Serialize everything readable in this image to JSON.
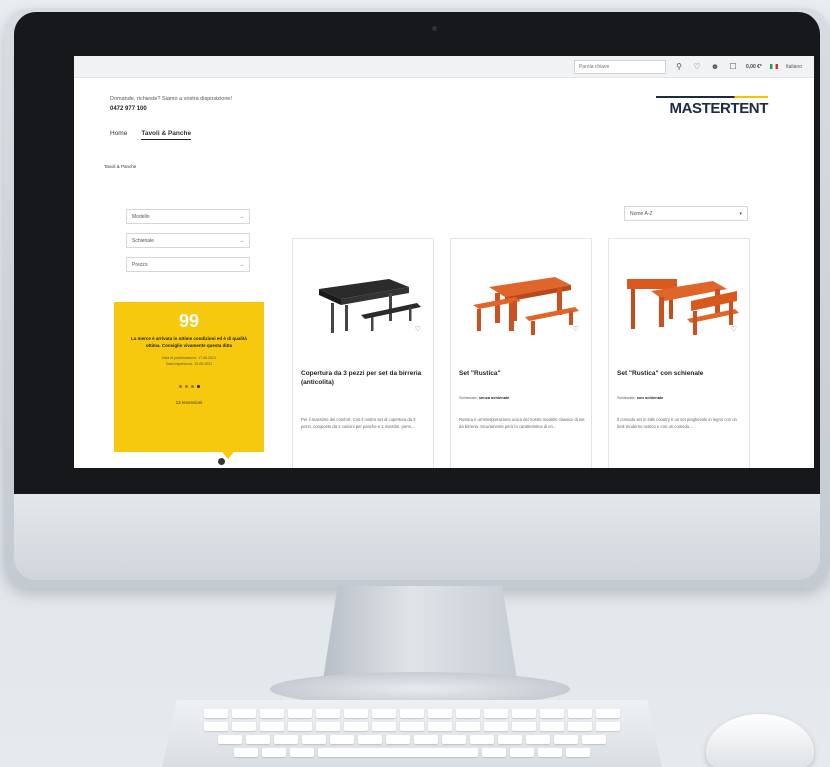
{
  "topbar": {
    "search_placeholder": "Parola chiave",
    "cart_total": "0,00 €*",
    "language": "Italiano"
  },
  "header": {
    "contact_text": "Domande, richieste? Siamo a vostra disposizione!",
    "phone": "0472 977 100",
    "logo": "MASTERTENT"
  },
  "nav": {
    "items": [
      "Home",
      "Tavoli & Panche"
    ]
  },
  "breadcrumb": "Tavoli & Panche",
  "filters": [
    "Modello",
    "Schienale",
    "Prezzo"
  ],
  "sort": {
    "selected": "Nome A-Z"
  },
  "review": {
    "quote": "99",
    "text": "La merce è arrivata in ottime condizioni ed è di qualità ottima. Consiglio vivamente questa ditta",
    "published": "Data di pubblicazione: 17.06.2021",
    "experience": "Data esperienza: 15.06.2021",
    "count": "13 recensioni"
  },
  "products": [
    {
      "title": "Copertura da 3 pezzi per set da birreria (anticolita)",
      "meta_label": "",
      "meta_value": "",
      "desc": "Per il massimo del comfort: Con il nostro set di copertura da 3 pezzi, composto da 2 cuscini per panche e 1 rivestim. perm..."
    },
    {
      "title": "Set \"Rustica\"",
      "meta_label": "Schienale:",
      "meta_value": "senza schienale",
      "desc": "Rustica è un'interpretazione unica del nostro modello classico di set da birreria. Sicuramente però la caratteristica di un..."
    },
    {
      "title": "Set \"Rustica\" con schienale",
      "meta_label": "Schienale:",
      "meta_value": "con schienale",
      "desc": "Il comodo set in stile country è un set pieghevole in legno con un look moderno rustico e con un comodo..."
    }
  ],
  "colors": {
    "accent_yellow": "#f6c90f",
    "logo_navy": "#1c2a44",
    "wood": "#d8581e",
    "bezel": "#16181b"
  }
}
